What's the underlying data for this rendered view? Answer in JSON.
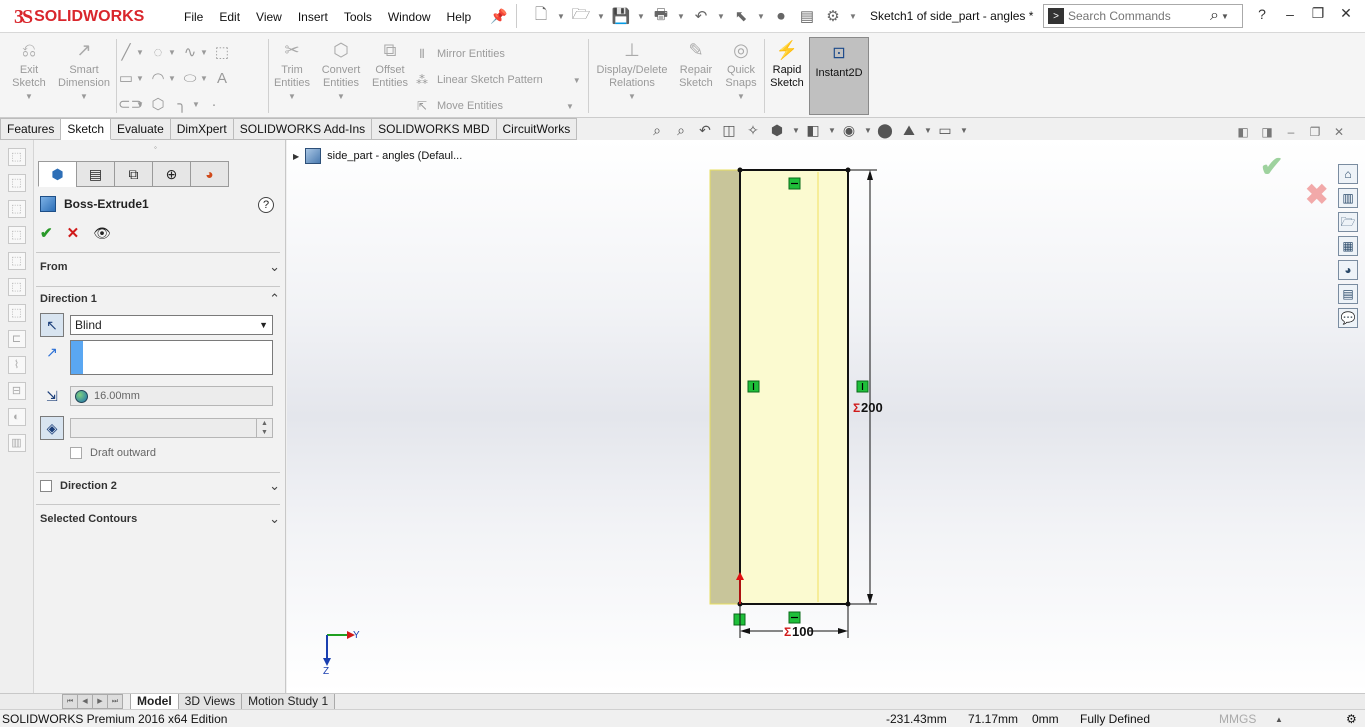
{
  "app": {
    "logo_symbol": "3S",
    "logo_text": "SOLIDWORKS",
    "document_title": "Sketch1 of side_part - angles *",
    "accent_color": "#d9262c"
  },
  "menu": [
    "File",
    "Edit",
    "View",
    "Insert",
    "Tools",
    "Window",
    "Help"
  ],
  "search": {
    "placeholder": "Search Commands"
  },
  "window_controls": {
    "help": "?",
    "minimize": "–",
    "restore": "❐",
    "close": "✕"
  },
  "command_manager": {
    "exit_sketch": "Exit Sketch",
    "smart_dimension": "Smart Dimension",
    "trim_entities": "Trim Entities",
    "convert_entities": "Convert Entities",
    "offset_entities": "Offset Entities",
    "mirror_entities": "Mirror Entities",
    "linear_sketch_pattern": "Linear Sketch Pattern",
    "move_entities": "Move Entities",
    "display_delete_relations": "Display/Delete Relations",
    "repair_sketch": "Repair Sketch",
    "quick_snaps": "Quick Snaps",
    "rapid_sketch": "Rapid Sketch",
    "instant2d": "Instant2D"
  },
  "tabs": [
    "Features",
    "Sketch",
    "Evaluate",
    "DimXpert",
    "SOLIDWORKS Add-Ins",
    "SOLIDWORKS MBD",
    "CircuitWorks"
  ],
  "active_tab": "Sketch",
  "property_manager": {
    "title": "Boss-Extrude1",
    "help": "?",
    "from_label": "From",
    "direction1_label": "Direction 1",
    "end_condition": "Blind",
    "depth_value": "16.00mm",
    "draft_outward_label": "Draft outward",
    "direction2_label": "Direction 2",
    "selected_contours_label": "Selected Contours"
  },
  "feature_tree": {
    "root_label": "side_part - angles  (Defaul..."
  },
  "sketch": {
    "height_dimension": "200",
    "width_dimension": "100",
    "fill_color": "#fbfad0",
    "side_face_color": "#c8c59a",
    "relation_color": "#1fbf3a"
  },
  "triad": {
    "y_label": "Y",
    "z_label": "Z"
  },
  "bottom_tabs": [
    "Model",
    "3D Views",
    "Motion Study 1"
  ],
  "active_bottom_tab": "Model",
  "status_bar": {
    "edition": "SOLIDWORKS Premium 2016 x64 Edition",
    "x_coord": "-231.43mm",
    "y_coord": "71.17mm",
    "z_coord": "0mm",
    "sketch_state": "Fully Defined",
    "units": "MMGS"
  }
}
